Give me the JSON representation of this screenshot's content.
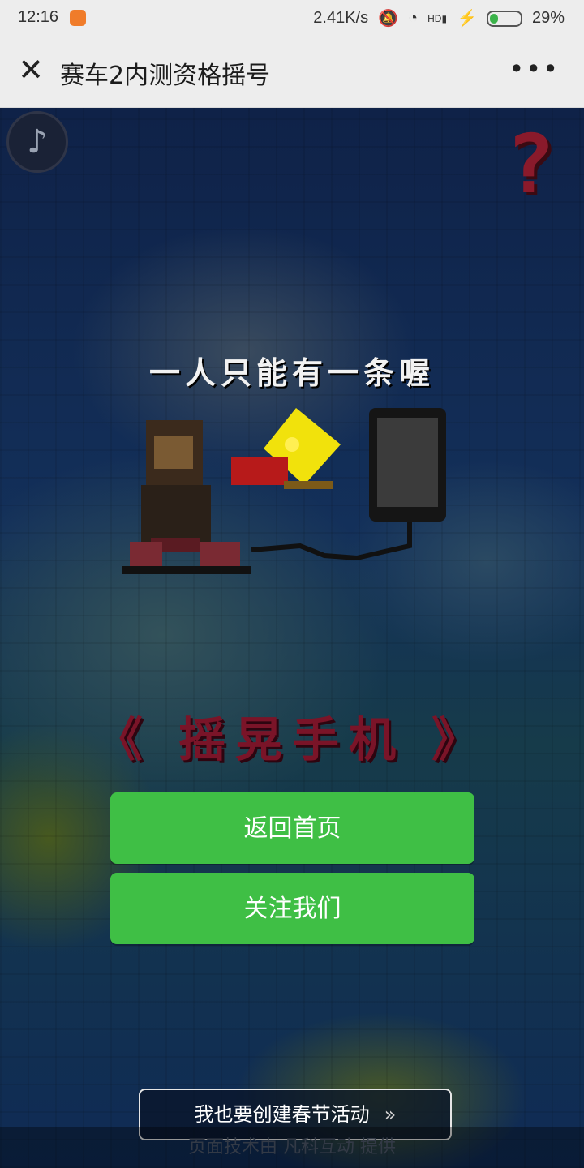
{
  "status_bar": {
    "time": "12:16",
    "network_speed": "2.41K/s",
    "battery_percent": "29%",
    "battery_level": 0.29,
    "icons": [
      "app-notification-icon",
      "mute-icon",
      "wifi-icon",
      "hd-signal-icon",
      "charging-icon",
      "battery-icon"
    ]
  },
  "nav": {
    "close_icon": "close-icon",
    "title": "赛车2内测资格摇号",
    "more_label": "•••"
  },
  "content": {
    "music_icon": "music-note-icon",
    "help_label": "?",
    "headline": "一人只能有一条喔",
    "illustration": "pixel-art character, pizza slice and phone",
    "shake_text": "《 摇晃手机 》",
    "buttons": {
      "home": "返回首页",
      "follow": "关注我们"
    },
    "create_event": {
      "label": "我也要创建春节活动",
      "chevron": "»"
    },
    "footer": "页面技术由 凡科互动 提供"
  },
  "colors": {
    "button_green": "#3fbf45",
    "nav_bg": "#ededed",
    "shake_red": "#7a1428",
    "background": "#0f2248"
  }
}
